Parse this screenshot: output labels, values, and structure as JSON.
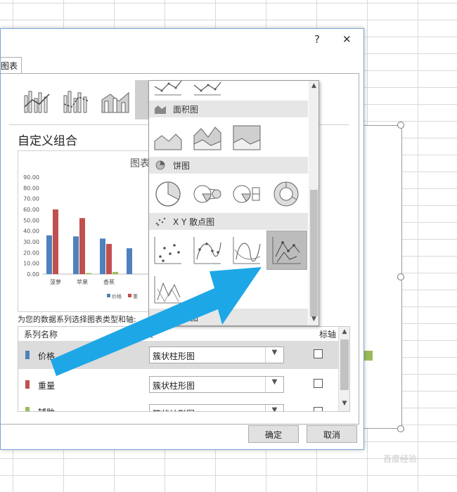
{
  "dialog": {
    "help_label": "?",
    "close_label": "✕",
    "tab_label": "图表",
    "section_title": "自定义组合",
    "preview_title": "图表",
    "instruction": "为您的数据系列选择图表类型和轴:",
    "ok_label": "确定",
    "cancel_label": "取消"
  },
  "series_table": {
    "columns": [
      "系列名称",
      "图表",
      "标轴"
    ],
    "rows": [
      {
        "name": "价格",
        "chart_type": "簇状柱形图",
        "color": "#4f81bd",
        "selected": true
      },
      {
        "name": "重量",
        "chart_type": "簇状柱形图",
        "color": "#c0504d",
        "selected": false
      },
      {
        "name": "辅助",
        "chart_type": "簇状柱形图",
        "color": "#9bbb59",
        "selected": false
      }
    ]
  },
  "dropdown": {
    "categories": [
      {
        "label": "面积图",
        "icon": "area-chart-icon"
      },
      {
        "label": "饼图",
        "icon": "pie-chart-icon"
      },
      {
        "label": "X Y 散点图",
        "icon": "scatter-chart-icon"
      },
      {
        "label": "雷达图",
        "icon": "radar-chart-icon"
      }
    ]
  },
  "chart_data": {
    "type": "bar",
    "categories": [
      "菠萝",
      "苹果",
      "香蕉",
      ""
    ],
    "series": [
      {
        "name": "价格",
        "values": [
          36,
          35,
          33,
          24
        ],
        "color": "#4f81bd"
      },
      {
        "name": "重量",
        "values": [
          60,
          52,
          28,
          0
        ],
        "color": "#c0504d"
      },
      {
        "name": "辅助",
        "values": [
          0,
          1,
          2,
          0
        ],
        "color": "#9bbb59"
      }
    ],
    "yticks": [
      "90.00",
      "80.00",
      "70.00",
      "60.00",
      "50.00",
      "40.00",
      "30.00",
      "20.00",
      "10.00",
      "0.00"
    ],
    "ylim": [
      0,
      90
    ],
    "legend": [
      "价格",
      "重"
    ],
    "legend_position": "bottom",
    "grid": false
  },
  "colors": {
    "accent_arrow": "#1ea7e6",
    "selected_icon_bg": "#bcbcbc"
  },
  "watermark": "百度经验"
}
